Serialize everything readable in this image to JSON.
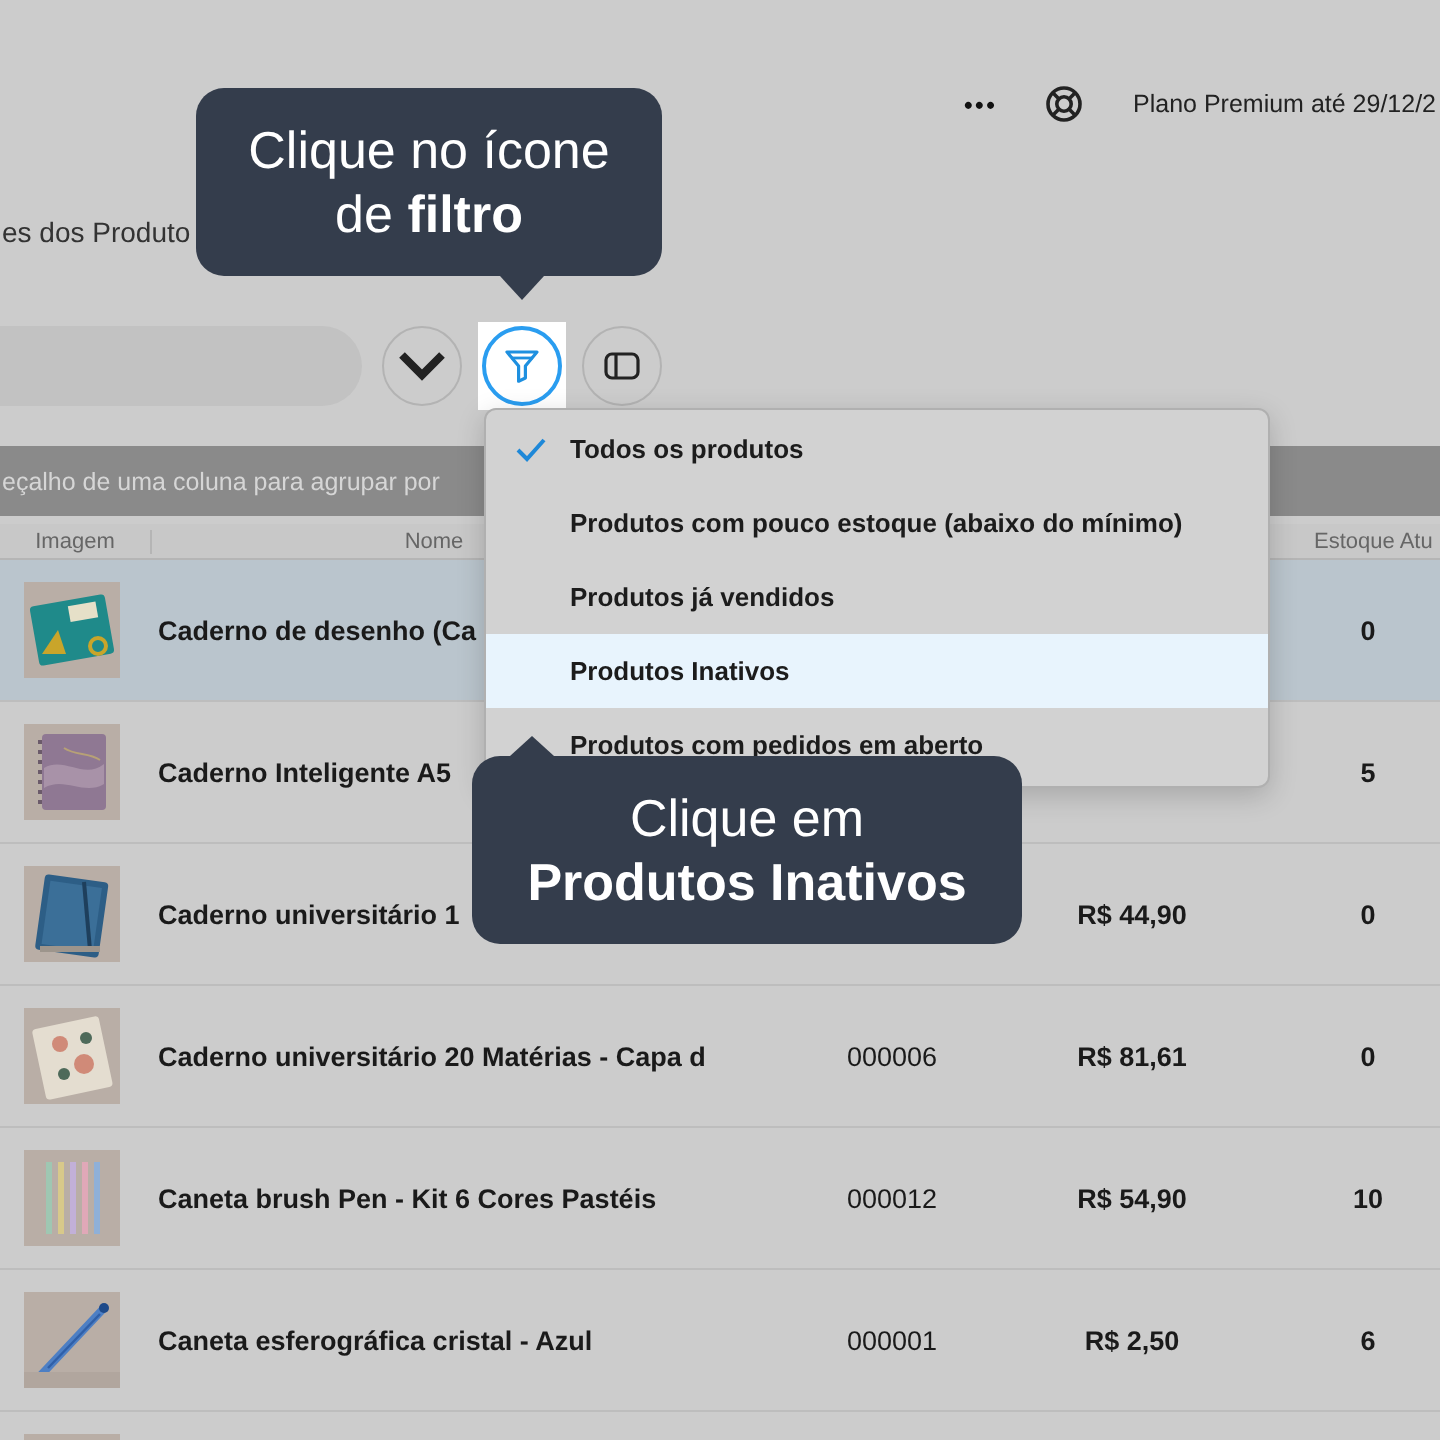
{
  "topbar": {
    "menu": "•••",
    "plan": "Plano Premium até 29/12/2"
  },
  "page_title": "es dos Produto",
  "toolbar": {
    "buttons": [
      {
        "kind": "chevron",
        "spotlight": false
      },
      {
        "kind": "filter",
        "spotlight": true
      },
      {
        "kind": "panel",
        "spotlight": false
      }
    ]
  },
  "group_hint": "eçalho de uma coluna para agrupar por",
  "table": {
    "columns": [
      {
        "label": "Imagem"
      },
      {
        "label": "Nome"
      },
      {
        "label": "Estoque Atu"
      }
    ],
    "rows": [
      {
        "name": "Caderno de desenho (Ca",
        "stock": "0",
        "selected": true
      },
      {
        "name": "Caderno Inteligente A5",
        "stock": "5",
        "selected": false
      },
      {
        "name": "Caderno universitário 1",
        "price": "R$ 44,90",
        "stock": "0",
        "selected": false
      },
      {
        "name": "Caderno universitário 20 Matérias  - Capa d",
        "code": "000006",
        "price": "R$ 81,61",
        "stock": "0",
        "selected": false
      },
      {
        "name": "Caneta brush Pen - Kit 6 Cores Pastéis",
        "code": "000012",
        "price": "R$ 54,90",
        "stock": "10",
        "selected": false
      },
      {
        "name": "Caneta esferográfica cristal - Azul",
        "code": "000001",
        "price": "R$ 2,50",
        "stock": "6",
        "selected": false
      },
      {
        "selected": false
      }
    ]
  },
  "filter_menu": {
    "items": [
      {
        "label": "Todos os produtos",
        "checked": true,
        "highlighted": false
      },
      {
        "label": "Produtos com pouco estoque (abaixo do mínimo)",
        "checked": false,
        "highlighted": false
      },
      {
        "label": "Produtos já vendidos",
        "checked": false,
        "highlighted": false
      },
      {
        "label": "Produtos Inativos",
        "checked": false,
        "highlighted": true
      },
      {
        "label": "Produtos com pedidos em aberto",
        "checked": false,
        "highlighted": false
      }
    ]
  },
  "callouts": [
    {
      "lines": [
        "Clique no ícone",
        "de **filtro**"
      ]
    },
    {
      "lines": [
        "Clique em",
        "**Produtos Inativos**"
      ]
    }
  ]
}
